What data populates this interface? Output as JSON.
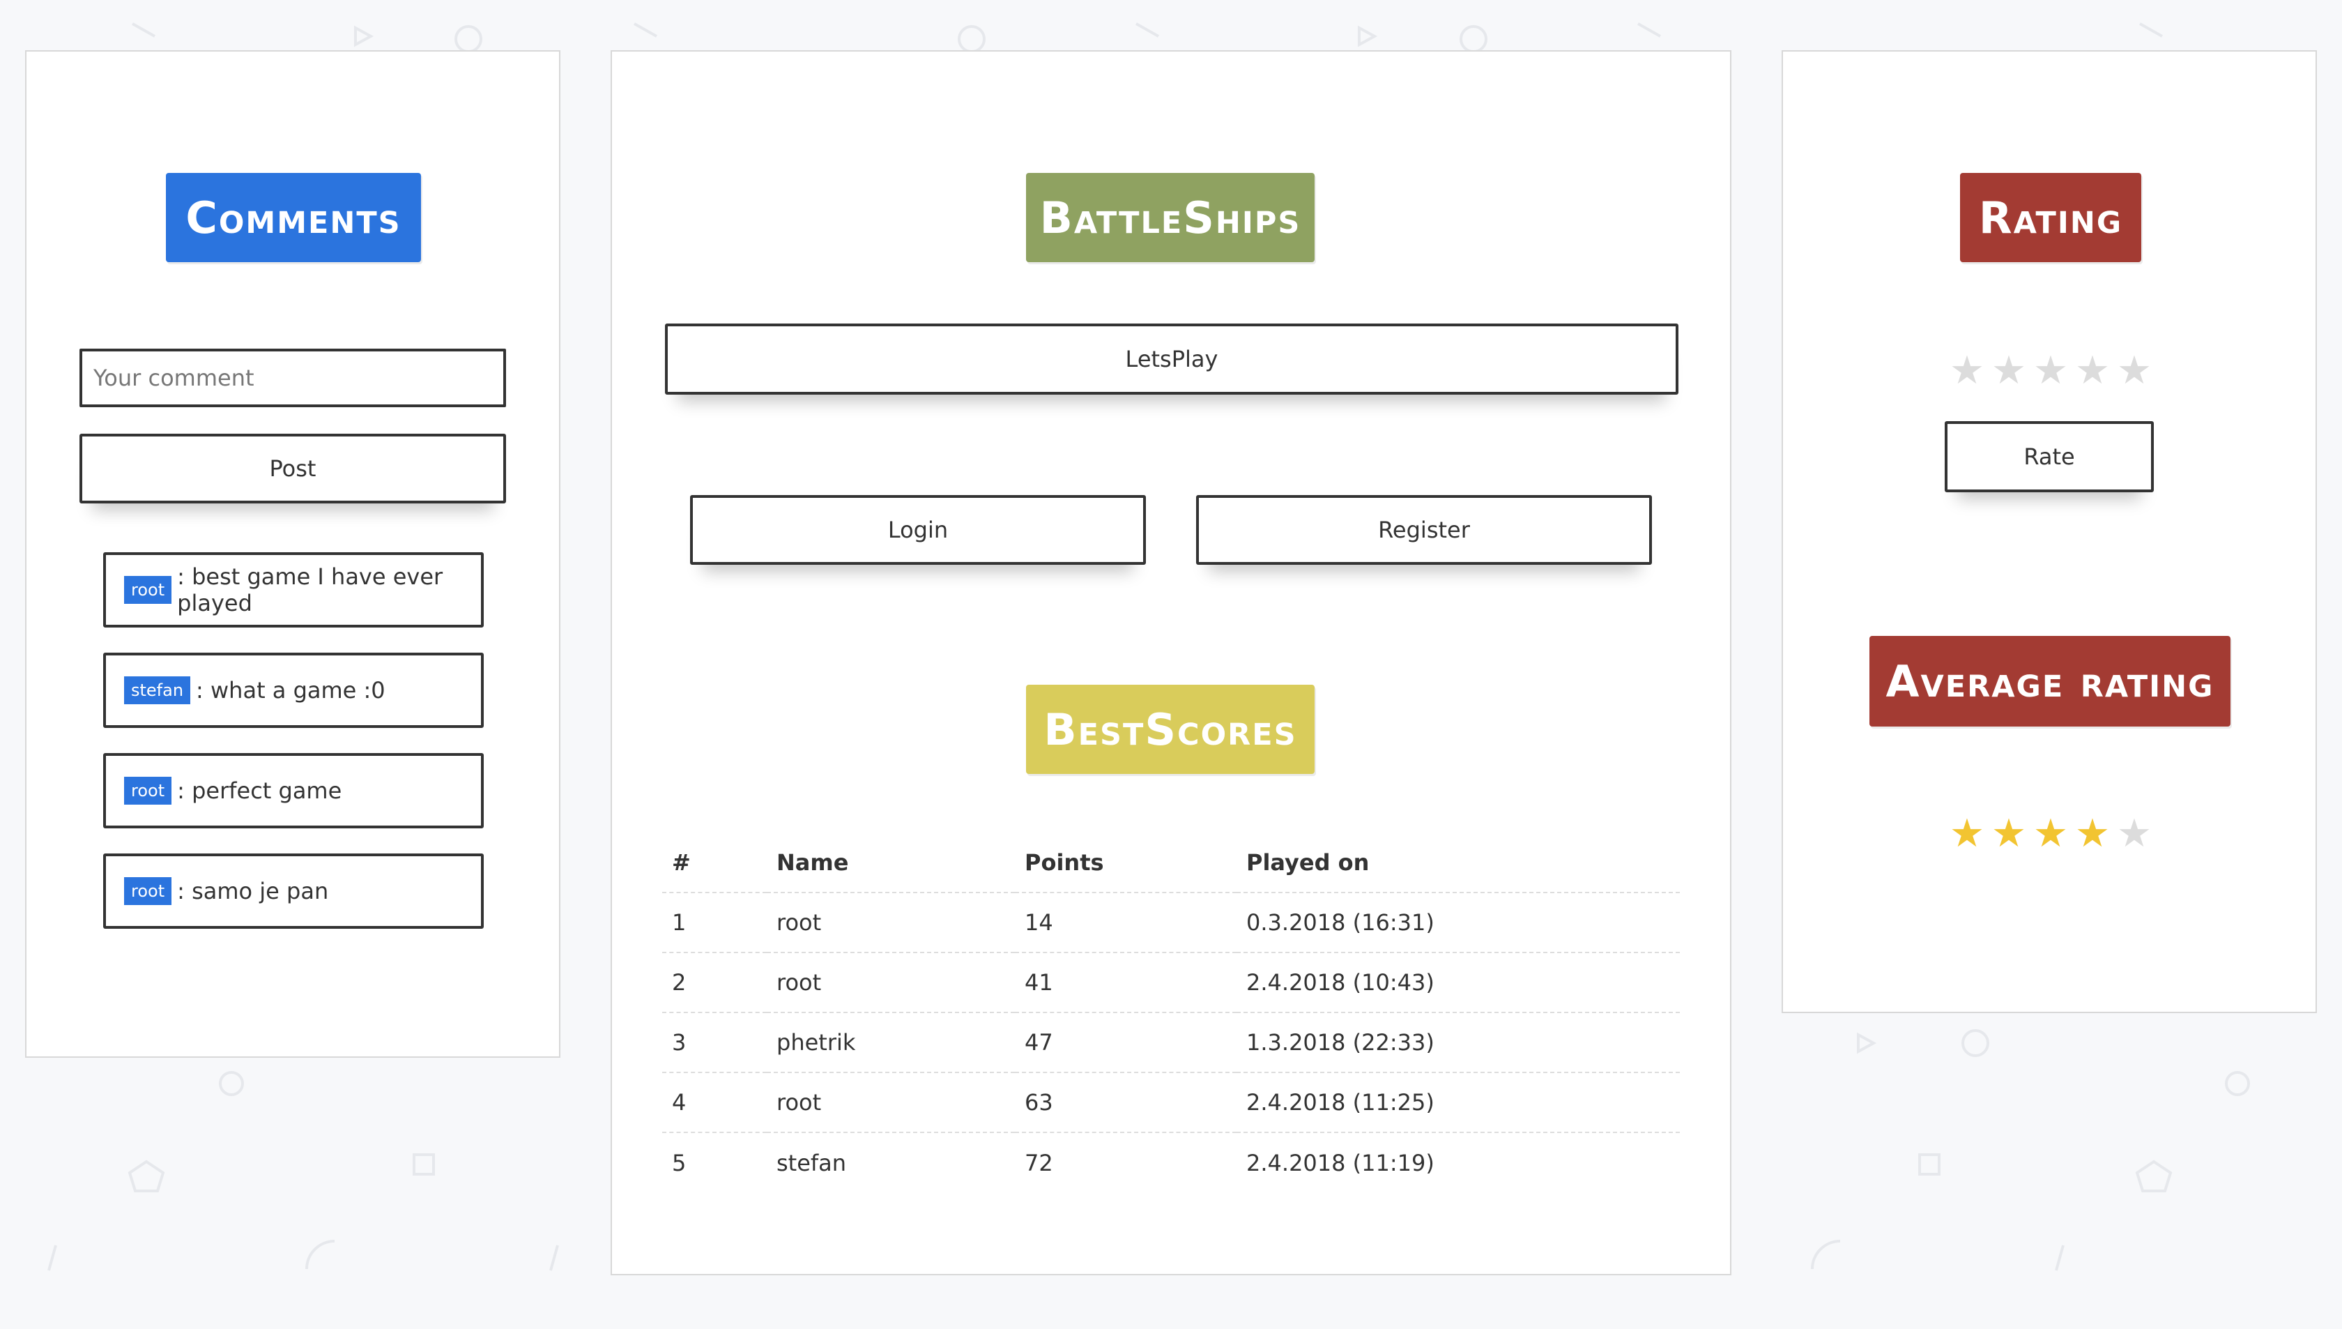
{
  "comments_panel": {
    "title": "Comments",
    "input_placeholder": "Your comment",
    "post_label": "Post",
    "items": [
      {
        "user": "root",
        "text": ": best game I have ever played"
      },
      {
        "user": "stefan",
        "text": ": what a game :0"
      },
      {
        "user": "root",
        "text": ": perfect game"
      },
      {
        "user": "root",
        "text": ": samo je pan"
      }
    ]
  },
  "game_panel": {
    "title": "BattleShips",
    "play_label": "LetsPlay",
    "login_label": "Login",
    "register_label": "Register",
    "scores_title": "BestScores",
    "table": {
      "headers": [
        "#",
        "Name",
        "Points",
        "Played on"
      ],
      "rows": [
        [
          "1",
          "root",
          "14",
          "0.3.2018 (16:31)"
        ],
        [
          "2",
          "root",
          "41",
          "2.4.2018 (10:43)"
        ],
        [
          "3",
          "phetrik",
          "47",
          "1.3.2018 (22:33)"
        ],
        [
          "4",
          "root",
          "63",
          "2.4.2018 (11:25)"
        ],
        [
          "5",
          "stefan",
          "72",
          "2.4.2018 (11:19)"
        ]
      ]
    }
  },
  "rating_panel": {
    "title": "Rating",
    "rate_label": "Rate",
    "user_rating": 0,
    "average_title": "Average rating",
    "average_rating": 4,
    "max_stars": 5
  },
  "colors": {
    "comments_heading": "#2b74de",
    "battleships_heading": "#8fa261",
    "bestscores_heading": "#d9cc5b",
    "rating_heading": "#a33b33",
    "star_full": "#f2c431",
    "star_empty": "#dcdcdc"
  }
}
